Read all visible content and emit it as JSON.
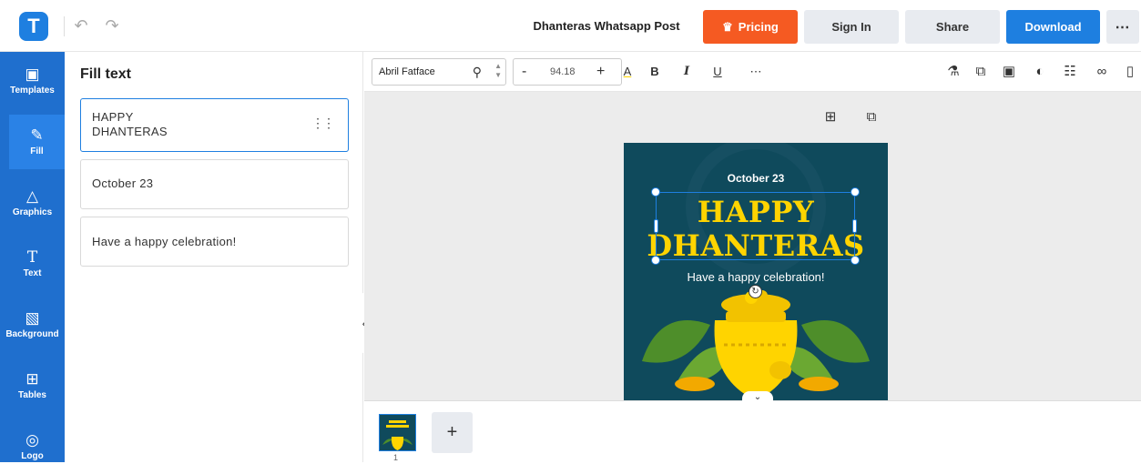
{
  "app": {
    "logo_letter": "T",
    "document_title": "Dhanteras Whatsapp Post"
  },
  "header": {
    "undo_icon": "undo-icon",
    "redo_icon": "redo-icon",
    "pricing_label": "Pricing",
    "signin_label": "Sign In",
    "share_label": "Share",
    "download_label": "Download",
    "more_label": "⋯"
  },
  "colors": {
    "brand_blue": "#1e7fe0",
    "pricing_orange": "#f55a22",
    "rail_blue": "#1f6fce",
    "post_bg": "#0f4a5c",
    "title_yellow": "#ffd400"
  },
  "sidebar": {
    "items": [
      {
        "label": "Templates",
        "icon": "templates-icon"
      },
      {
        "label": "Fill",
        "icon": "pencil-icon"
      },
      {
        "label": "Graphics",
        "icon": "shapes-icon"
      },
      {
        "label": "Text",
        "icon": "text-icon"
      },
      {
        "label": "Background",
        "icon": "background-icon"
      },
      {
        "label": "Tables",
        "icon": "table-icon"
      },
      {
        "label": "Logo",
        "icon": "logo-icon"
      }
    ]
  },
  "panel": {
    "title": "Fill text",
    "items": [
      {
        "line1": "HAPPY",
        "line2": "DHANTERAS"
      },
      {
        "line1": "October 23"
      },
      {
        "line1": "Have a happy celebration!"
      }
    ]
  },
  "format_toolbar": {
    "font_name": "Abril Fatface",
    "font_size": "94.18",
    "minus": "-",
    "plus": "+",
    "text_color_label": "A",
    "bold_label": "B",
    "italic_label": "I",
    "underline_label": "U",
    "more_label": "⋯"
  },
  "post": {
    "date": "October 23",
    "title_line1": "HAPPY",
    "title_line2": "DHANTERAS",
    "subtitle": "Have a happy celebration!"
  },
  "pages": {
    "current_page": "1",
    "add_label": "+"
  }
}
